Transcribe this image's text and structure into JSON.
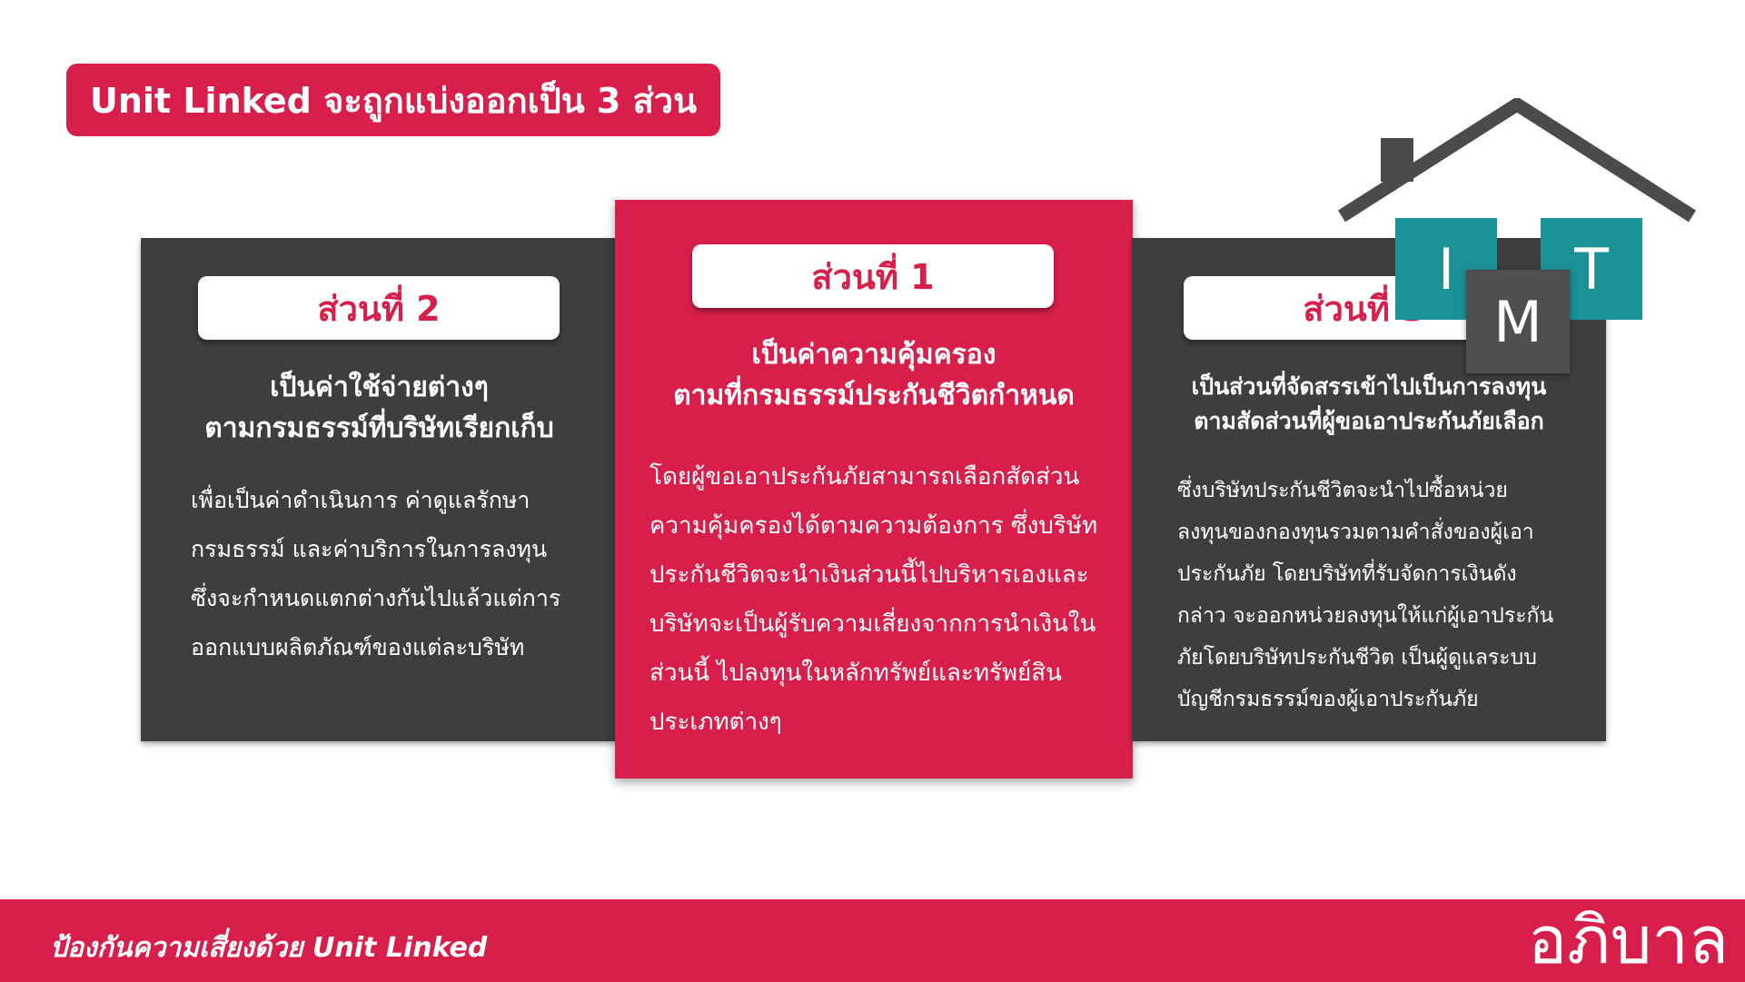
{
  "title": "Unit Linked จะถูกแบ่งออกเป็น 3 ส่วน",
  "parts": {
    "left": {
      "label": "ส่วนที่ 2",
      "heading_line1": "เป็นค่าใช้จ่ายต่างๆ",
      "heading_line2": "ตามกรมธรรม์ที่บริษัทเรียกเก็บ",
      "body": "เพื่อเป็นค่าดำเนินการ ค่าดูแลรักษากรมธรรม์ และค่าบริการในการลงทุน ซึ่งจะกำหนดแตกต่างกันไปแล้วแต่การออกแบบผลิตภัณฑ์ของแต่ละบริษัท"
    },
    "center": {
      "label": "ส่วนที่ 1",
      "heading_line1": "เป็นค่าความคุ้มครอง",
      "heading_line2": "ตามที่กรมธรรม์ประกันชีวิตกำหนด",
      "body": "โดยผู้ขอเอาประกันภัยสามารถเลือกสัดส่วนความคุ้มครองได้ตามความต้องการ ซึ่งบริษัทประกันชีวิตจะนำเงินส่วนนี้ไปบริหารเองและบริษัทจะเป็นผู้รับความเสี่ยงจากการนำเงินในส่วนนี้ ไปลงทุนในหลักทรัพย์และทรัพย์สินประเภทต่างๆ"
    },
    "right": {
      "label": "ส่วนที่ 3",
      "heading_line1": "เป็นส่วนที่จัดสรรเข้าไปเป็นการลงทุน",
      "heading_line2": "ตามสัดส่วนที่ผู้ขอเอาประกันภัยเลือก",
      "body": "ซึ่งบริษัทประกันชีวิตจะนำไปซื้อหน่วยลงทุนของกองทุนรวมตามคำสั่งของผู้เอาประกันภัย โดยบริษัทที่รับจัดการเงินดังกล่าว จะออกหน่วยลงทุนให้แก่ผู้เอาประกันภัยโดยบริษัทประกันชีวิต เป็นผู้ดูแลระบบบัญชีกรมธรรม์ของผู้เอาประกันภัย"
    }
  },
  "logo_boxes": {
    "i": "I",
    "m": "M",
    "t": "T"
  },
  "footer": {
    "tagline": "ป้องกันความเสี่ยงด้วย Unit Linked",
    "brand": "อภิบาล"
  },
  "colors": {
    "brand_red": "#d81f4b",
    "panel_dark": "#3d3e3f",
    "teal": "#1a9197",
    "grey_box": "#4d4f51",
    "roof": "#4a4b4c"
  }
}
